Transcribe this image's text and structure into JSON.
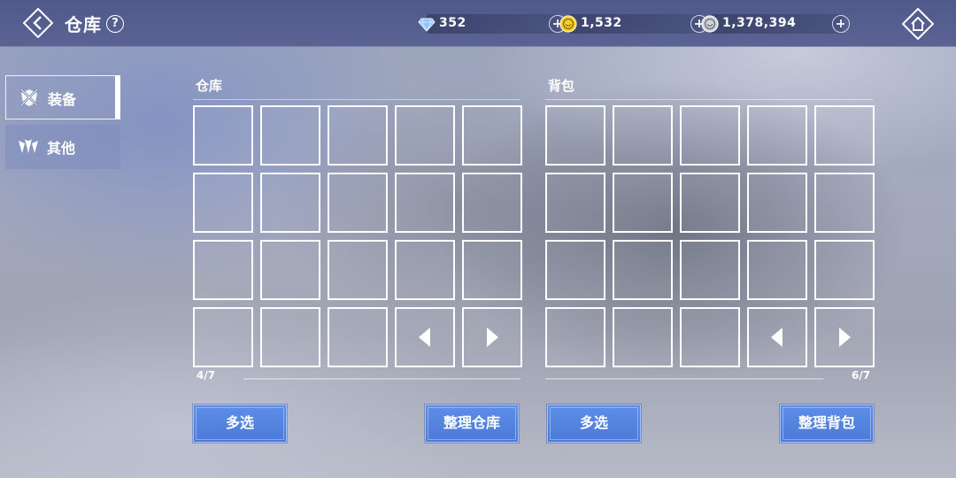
{
  "header": {
    "title": "仓库",
    "help_glyph": "?",
    "currencies": [
      {
        "icon": "diamond-icon",
        "value": "352",
        "color": "#9ccfff"
      },
      {
        "icon": "gold-coin-icon",
        "value": "1,532",
        "color": "#f6d53a"
      },
      {
        "icon": "silver-coin-icon",
        "value": "1,378,394",
        "color": "#d7d9de"
      }
    ]
  },
  "sidebar": {
    "tabs": [
      {
        "label": "装备",
        "icon": "equipment-icon",
        "selected": true
      },
      {
        "label": "其他",
        "icon": "other-items-icon",
        "selected": false
      }
    ]
  },
  "warehouse": {
    "title": "仓库",
    "page": "4/7",
    "multi_select_label": "多选",
    "sort_label": "整理仓库"
  },
  "backpack": {
    "title": "背包",
    "page": "6/7",
    "multi_select_label": "多选",
    "sort_label": "整理背包"
  },
  "colors": {
    "topbar": "#535d8e",
    "button": "#5585e0",
    "slot_border": "#ffffff"
  }
}
